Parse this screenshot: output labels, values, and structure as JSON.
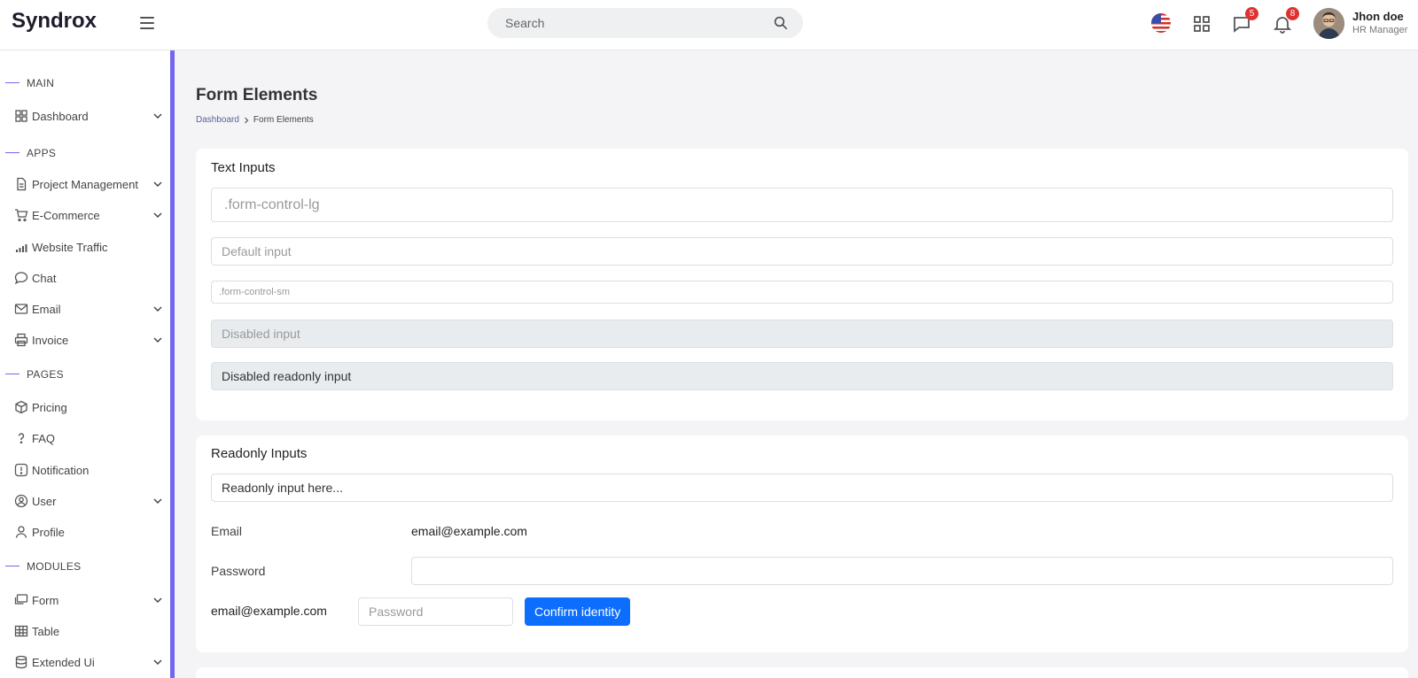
{
  "header": {
    "logo": "Syndrox",
    "search_placeholder": "Search",
    "chat_badge": "5",
    "notification_badge": "8",
    "user_name": "Jhon doe",
    "user_role": "HR Manager"
  },
  "sidebar": {
    "sections": {
      "main": "MAIN",
      "apps": "APPS",
      "pages": "PAGES",
      "modules": "MODULES"
    },
    "items": [
      {
        "label": "Dashboard",
        "icon": "grid-icon"
      },
      {
        "label": "Project Management",
        "icon": "document-icon"
      },
      {
        "label": "E-Commerce",
        "icon": "cart-icon"
      },
      {
        "label": "Website Traffic",
        "icon": "bar-chart-icon"
      },
      {
        "label": "Chat",
        "icon": "chat-bubble-icon"
      },
      {
        "label": "Email",
        "icon": "envelope-icon"
      },
      {
        "label": "Invoice",
        "icon": "printer-icon"
      },
      {
        "label": "Pricing",
        "icon": "box-icon"
      },
      {
        "label": "FAQ",
        "icon": "question-icon"
      },
      {
        "label": "Notification",
        "icon": "alert-icon"
      },
      {
        "label": "User",
        "icon": "user-circle-icon"
      },
      {
        "label": "Profile",
        "icon": "person-icon"
      },
      {
        "label": "Form",
        "icon": "form-icon"
      },
      {
        "label": "Table",
        "icon": "table-icon"
      },
      {
        "label": "Extended Ui",
        "icon": "layers-icon"
      }
    ]
  },
  "main": {
    "page_title": "Form Elements",
    "breadcrumb": {
      "home": "Dashboard",
      "current": "Form Elements"
    },
    "text_inputs": {
      "title": "Text Inputs",
      "lg_placeholder": ".form-control-lg",
      "default_placeholder": "Default input",
      "sm_placeholder": ".form-control-sm",
      "disabled_placeholder": "Disabled input",
      "disabled_readonly_value": "Disabled readonly input"
    },
    "readonly_inputs": {
      "title": "Readonly Inputs",
      "readonly_value": "Readonly input here...",
      "email_label": "Email",
      "email_value": "email@example.com",
      "password_label": "Password",
      "inline_email": "email@example.com",
      "inline_password_placeholder": "Password",
      "confirm_button": "Confirm identity"
    }
  },
  "colors": {
    "accent": "#7367f0",
    "primary": "#0d6efd",
    "badge": "#e03131"
  }
}
